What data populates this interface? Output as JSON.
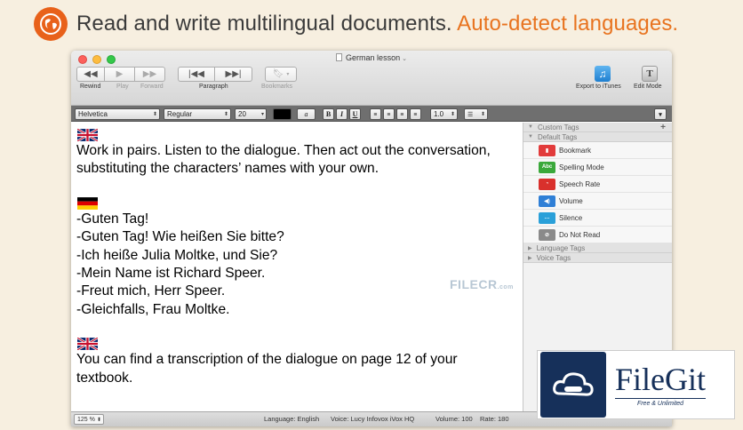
{
  "banner": {
    "text": "Read and write multilingual documents.",
    "accent": "Auto-detect languages."
  },
  "window": {
    "title": "German lesson",
    "toolbar": {
      "rewind": "Rewind",
      "play": "Play",
      "forward": "Forward",
      "paragraph": "Paragraph",
      "bookmarks": "Bookmarks",
      "export": "Export to iTunes",
      "edit_mode": "Edit Mode"
    },
    "format": {
      "font": "Helvetica",
      "style": "Regular",
      "size": "20",
      "spacing": "1.0",
      "bold": "B",
      "italic": "I",
      "underline": "U"
    }
  },
  "document": {
    "para1": "Work in pairs. Listen to the dialogue. Then act out the conversation, substituting the characters’ names with your own.",
    "german_lines": [
      "-Guten Tag!",
      "-Guten Tag! Wie heißen Sie bitte?",
      "-Ich heiße Julia Moltke, und Sie?",
      "-Mein Name ist Richard Speer.",
      "-Freut mich, Herr Speer.",
      "-Gleichfalls, Frau Moltke."
    ],
    "para3": "You can find a transcription of the dialogue on page 12 of your textbook."
  },
  "sidebar": {
    "custom_tags": "Custom Tags",
    "default_tags": "Default Tags",
    "items": [
      {
        "label": "Bookmark",
        "icon": "bookmark-icon",
        "color": "#e23b3b"
      },
      {
        "label": "Spelling Mode",
        "icon": "abc-icon",
        "color": "#3aa83a"
      },
      {
        "label": "Speech Rate",
        "icon": "speedometer-icon",
        "color": "#d9302c"
      },
      {
        "label": "Volume",
        "icon": "speaker-icon",
        "color": "#2f7fd6"
      },
      {
        "label": "Silence",
        "icon": "ellipsis-icon",
        "color": "#2aa0d9"
      },
      {
        "label": "Do Not Read",
        "icon": "no-read-icon",
        "color": "#8a8a8a"
      }
    ],
    "language_tags": "Language Tags",
    "voice_tags": "Voice Tags"
  },
  "status": {
    "zoom": "125 %",
    "language": "Language: English",
    "voice": "Voice: Lucy Infovox iVox HQ",
    "volume": "Volume: 100",
    "rate": "Rate: 180"
  },
  "watermarks": {
    "filecr": "FILECR",
    "filecr_suffix": ".com",
    "filegit_title": "FileGit",
    "filegit_sub": "Free & Unlimited"
  }
}
